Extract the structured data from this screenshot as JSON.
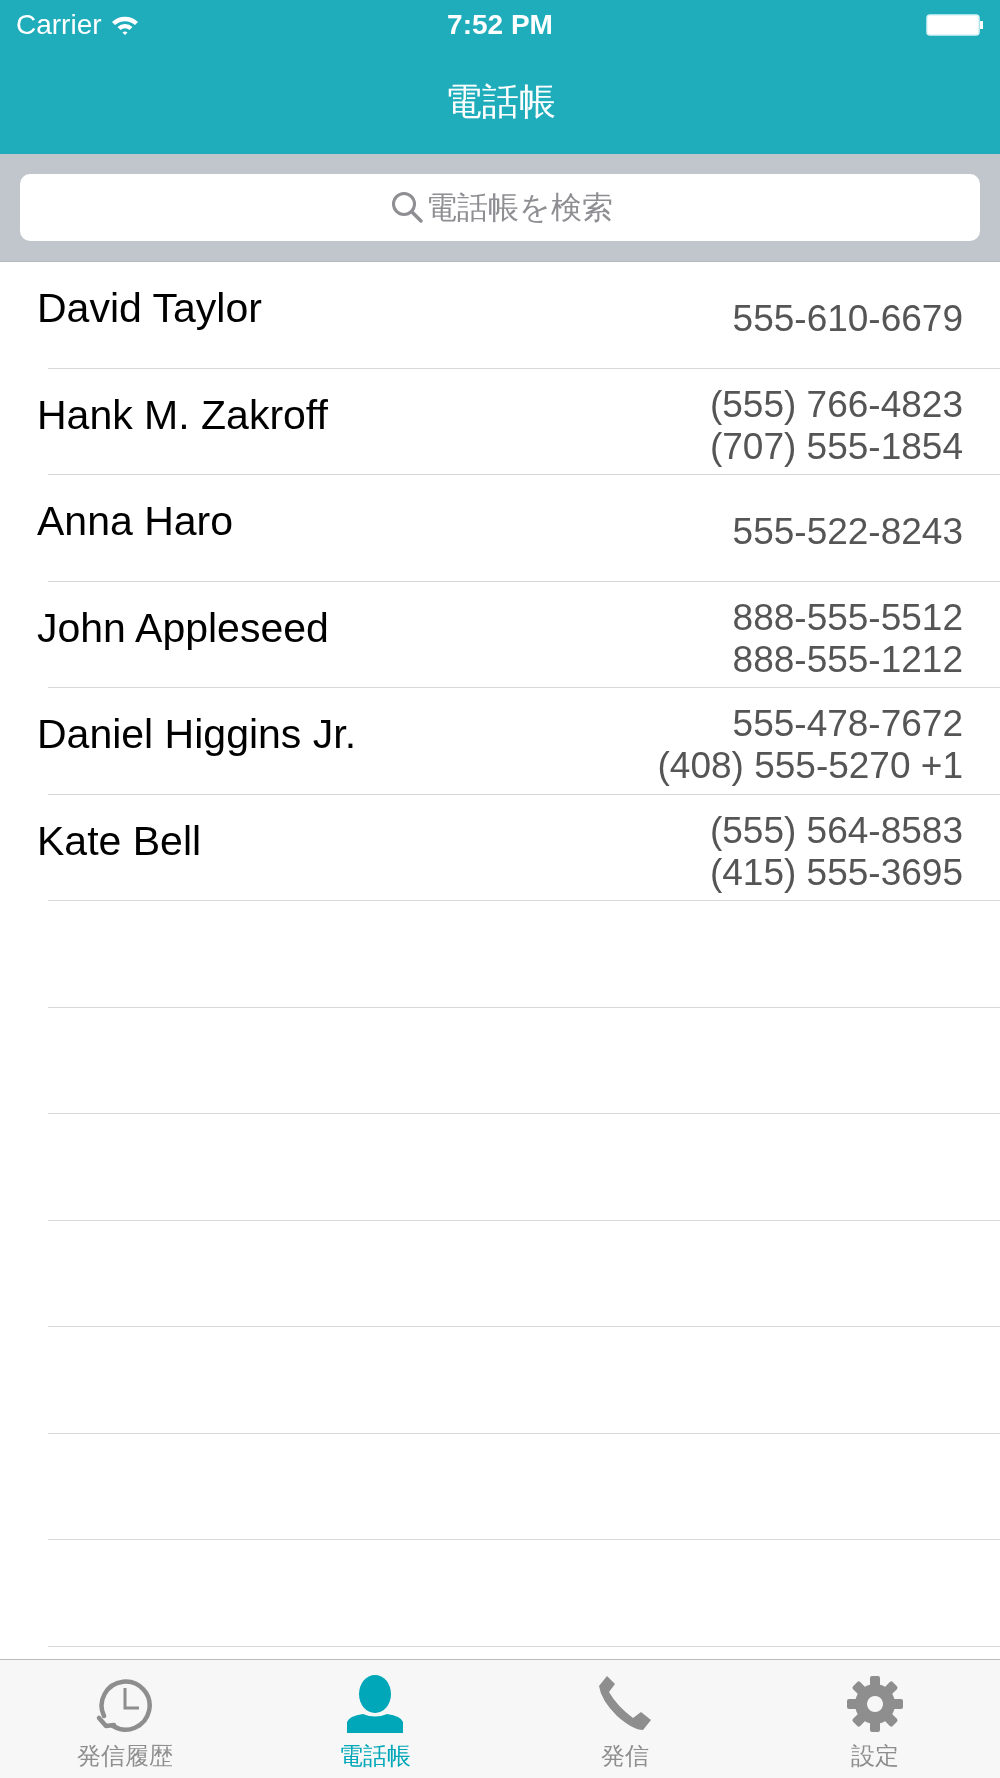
{
  "status_bar": {
    "carrier": "Carrier",
    "time": "7:52 PM"
  },
  "navigation_bar": {
    "title": "電話帳"
  },
  "search": {
    "placeholder": "電話帳を検索"
  },
  "contacts": [
    {
      "name": "David Taylor",
      "phones": [
        "555-610-6679"
      ]
    },
    {
      "name": "Hank M. Zakroff",
      "phones": [
        "(555) 766-4823",
        "(707) 555-1854"
      ]
    },
    {
      "name": "Anna Haro",
      "phones": [
        "555-522-8243"
      ]
    },
    {
      "name": "John Appleseed",
      "phones": [
        "888-555-5512",
        "888-555-1212"
      ]
    },
    {
      "name": "Daniel Higgins Jr.",
      "phones": [
        "555-478-7672",
        "(408) 555-5270 +1"
      ]
    },
    {
      "name": "Kate Bell",
      "phones": [
        "(555) 564-8583",
        "(415) 555-3695"
      ]
    }
  ],
  "tabs": [
    {
      "label": "発信履歴",
      "kind": "history",
      "selected": false
    },
    {
      "label": "電話帳",
      "kind": "contacts",
      "selected": true
    },
    {
      "label": "発信",
      "kind": "call",
      "selected": false
    },
    {
      "label": "設定",
      "kind": "settings",
      "selected": false
    }
  ]
}
